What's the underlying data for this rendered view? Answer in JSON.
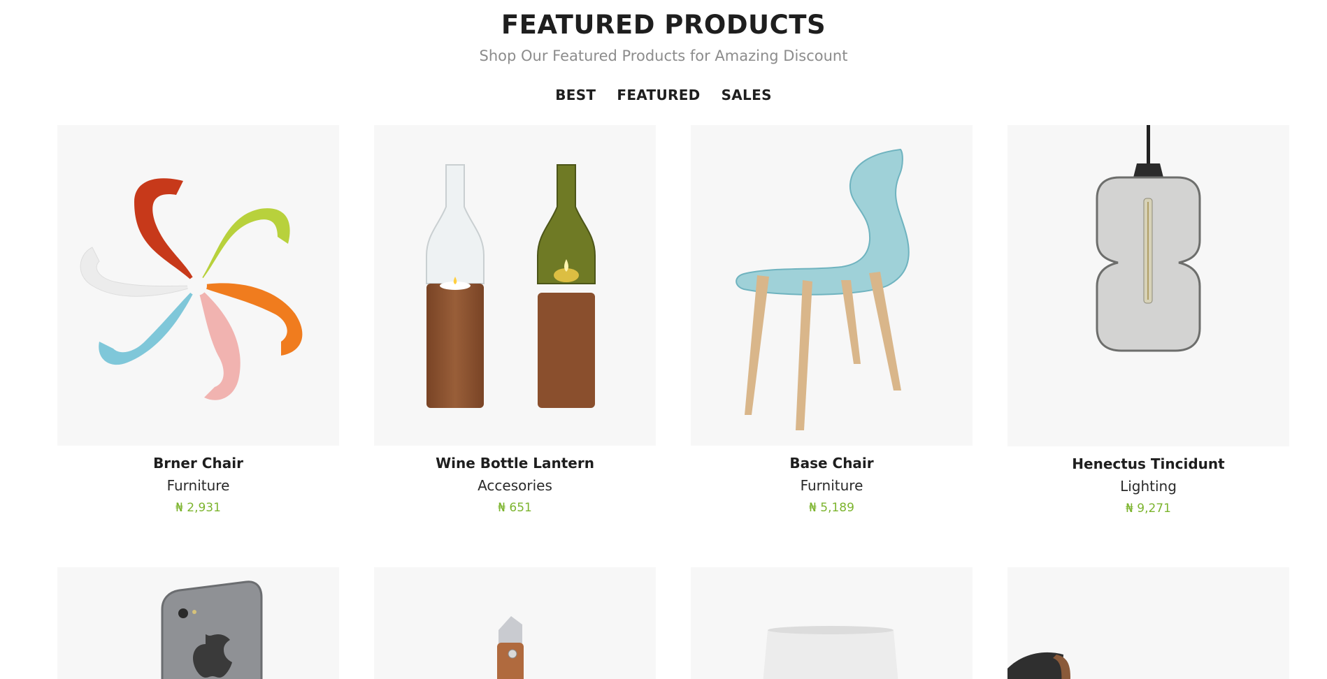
{
  "section": {
    "title": "FEATURED PRODUCTS",
    "subtitle": "Shop Our Featured Products for Amazing Discount"
  },
  "tabs": [
    {
      "label": "BEST"
    },
    {
      "label": "FEATURED"
    },
    {
      "label": "SALES"
    }
  ],
  "products": [
    {
      "name": "Brner Chair",
      "category": "Furniture",
      "price": "₦ 2,931",
      "image": "colorful-chairs-image"
    },
    {
      "name": "Wine Bottle Lantern",
      "category": "Accesories",
      "price": "₦ 651",
      "image": "wine-bottle-lantern-image"
    },
    {
      "name": "Base Chair",
      "category": "Furniture",
      "price": "₦ 5,189",
      "image": "blue-chair-image"
    },
    {
      "name": "Henectus Tincidunt",
      "category": "Lighting",
      "price": "₦ 9,271",
      "image": "pendant-lamp-image"
    }
  ],
  "products_row2": [
    {
      "image": "smartphone-image"
    },
    {
      "image": "knife-image"
    },
    {
      "image": "lamp-shade-image"
    },
    {
      "image": "lounge-chair-image"
    }
  ],
  "colors": {
    "accent_price": "#7cb42e",
    "thumb_bg": "#f7f7f7",
    "text_dark": "#1e1e1e",
    "text_muted": "#8c8c8c"
  }
}
